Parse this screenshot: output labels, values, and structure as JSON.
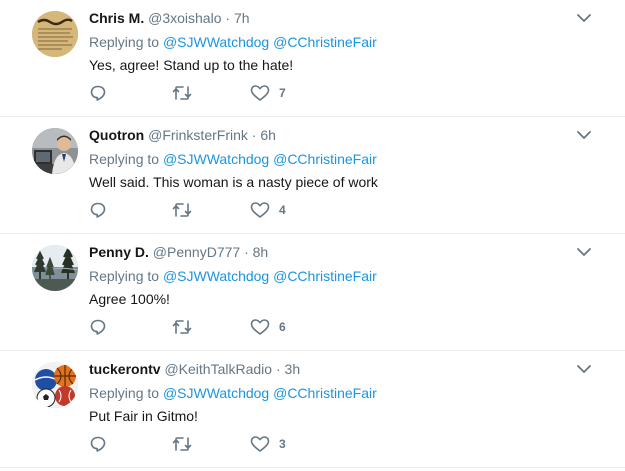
{
  "tweets": [
    {
      "name": "Chris M.",
      "handle": "@3xoishalo",
      "time": "7h",
      "replying_prefix": "Replying to",
      "mentions": [
        "@SJWWatchdog",
        "@CChristineFair"
      ],
      "text": "Yes, agree! Stand up to the hate!",
      "likes": "7",
      "avatar": "constitution-parchment"
    },
    {
      "name": "Quotron",
      "handle": "@FrinksterFrink",
      "time": "6h",
      "replying_prefix": "Replying to",
      "mentions": [
        "@SJWWatchdog",
        "@CChristineFair"
      ],
      "text": "Well said. This woman is a nasty piece of work",
      "likes": "4",
      "avatar": "man-at-computer"
    },
    {
      "name": "Penny D.",
      "handle": "@PennyD777",
      "time": "8h",
      "replying_prefix": "Replying to",
      "mentions": [
        "@SJWWatchdog",
        "@CChristineFair"
      ],
      "text": "Agree 100%!",
      "likes": "6",
      "avatar": "lake-with-trees"
    },
    {
      "name": "tuckerontv",
      "handle": "@KeithTalkRadio",
      "time": "3h",
      "replying_prefix": "Replying to",
      "mentions": [
        "@SJWWatchdog",
        "@CChristineFair"
      ],
      "text": "Put Fair in Gitmo!",
      "likes": "3",
      "avatar": "sports-balls"
    }
  ],
  "separator": "·",
  "colors": {
    "name": "#14171a",
    "meta": "#657786",
    "link": "#1b95e0",
    "divider": "#e6ecf0"
  }
}
